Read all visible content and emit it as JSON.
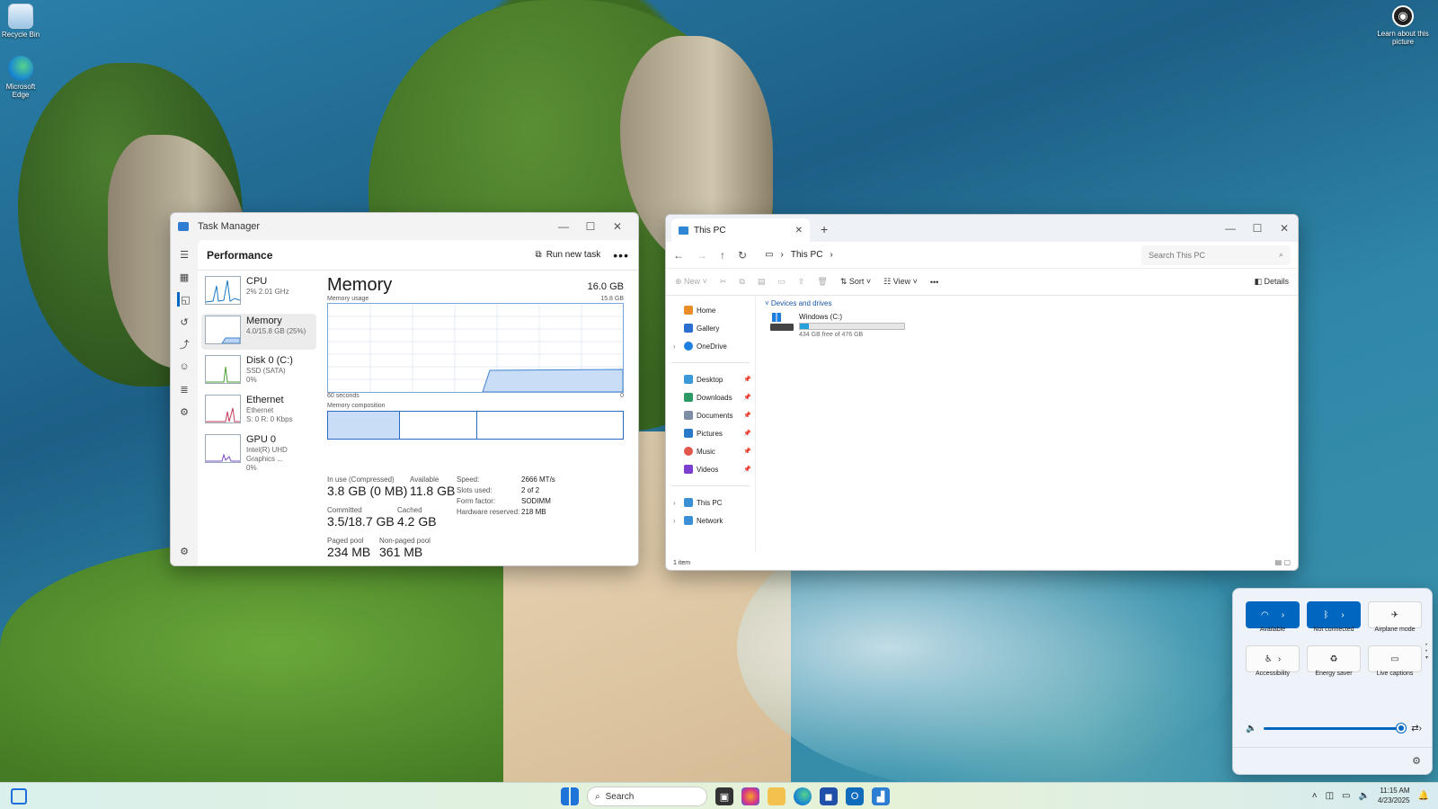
{
  "desktop": {
    "icons": [
      {
        "label": "Recycle Bin",
        "icon": "recycle-bin-icon"
      },
      {
        "label": "Microsoft Edge",
        "icon": "edge-icon"
      }
    ],
    "learn_label": "Learn about this picture"
  },
  "task_manager": {
    "title": "Task Manager",
    "section": "Performance",
    "run_new_task": "Run new task",
    "more": "•••",
    "perf_items": [
      {
        "name": "CPU",
        "sub1": "2% 2.01 GHz",
        "sub2": "",
        "color": "#1777c4"
      },
      {
        "name": "Memory",
        "sub1": "4.0/15.8 GB (25%)",
        "sub2": "",
        "color": "#3f83d1"
      },
      {
        "name": "Disk 0 (C:)",
        "sub1": "SSD (SATA)",
        "sub2": "0%",
        "color": "#4b9b2f"
      },
      {
        "name": "Ethernet",
        "sub1": "Ethernet",
        "sub2": "S: 0 R: 0 Kbps",
        "color": "#c33b5a"
      },
      {
        "name": "GPU 0",
        "sub1": "Intel(R) UHD Graphics ...",
        "sub2": "0%",
        "color": "#7a4cc2"
      }
    ],
    "memory": {
      "heading": "Memory",
      "total": "16.0 GB",
      "usage_label": "Memory usage",
      "usage_max": "15.8 GB",
      "time_left": "60 seconds",
      "time_right": "0",
      "composition_label": "Memory composition",
      "in_use_label": "In use (Compressed)",
      "in_use_value": "3.8 GB (0 MB)",
      "available_label": "Available",
      "available_value": "11.8 GB",
      "committed_label": "Committed",
      "committed_value": "3.5/18.7 GB",
      "cached_label": "Cached",
      "cached_value": "4.2 GB",
      "paged_label": "Paged pool",
      "paged_value": "234 MB",
      "nonpaged_label": "Non-paged pool",
      "nonpaged_value": "361 MB",
      "specs": [
        {
          "k": "Speed:",
          "v": "2666 MT/s"
        },
        {
          "k": "Slots used:",
          "v": "2 of 2"
        },
        {
          "k": "Form factor:",
          "v": "SODIMM"
        },
        {
          "k": "Hardware reserved:",
          "v": "218 MB"
        }
      ]
    }
  },
  "explorer": {
    "tab_title": "This PC",
    "breadcrumb": "This PC",
    "search_placeholder": "Search This PC",
    "cmd": {
      "new": "New",
      "sort": "Sort",
      "view": "View",
      "more": "•••",
      "details": "Details"
    },
    "nav": [
      {
        "label": "Home",
        "icon": "home-icon",
        "chev": "",
        "pin": false,
        "color": "#e88d2a"
      },
      {
        "label": "Gallery",
        "icon": "gallery-icon",
        "chev": "",
        "pin": false,
        "color": "#2a6fcf"
      },
      {
        "label": "OneDrive",
        "icon": "onedrive-icon",
        "chev": "›",
        "pin": false,
        "color": "#1f7fe0"
      },
      {
        "label": "Desktop",
        "icon": "desktop-folder-icon",
        "chev": "",
        "pin": true,
        "color": "#3a9ad9"
      },
      {
        "label": "Downloads",
        "icon": "downloads-icon",
        "chev": "",
        "pin": true,
        "color": "#2b9a64"
      },
      {
        "label": "Documents",
        "icon": "documents-icon",
        "chev": "",
        "pin": true,
        "color": "#7c8ea6"
      },
      {
        "label": "Pictures",
        "icon": "pictures-icon",
        "chev": "",
        "pin": true,
        "color": "#2a78c8"
      },
      {
        "label": "Music",
        "icon": "music-icon",
        "chev": "",
        "pin": true,
        "color": "#e2554b"
      },
      {
        "label": "Videos",
        "icon": "videos-icon",
        "chev": "",
        "pin": true,
        "color": "#7b3ed0"
      },
      {
        "label": "This PC",
        "icon": "this-pc-icon",
        "chev": "›",
        "pin": false,
        "color": "#3a8fd5"
      },
      {
        "label": "Network",
        "icon": "network-icon",
        "chev": "›",
        "pin": false,
        "color": "#3a8fd5"
      }
    ],
    "group": "Devices and drives",
    "drive_name": "Windows (C:)",
    "drive_free": "434 GB free of 476 GB",
    "drive_used_fraction": 0.088,
    "status": "1 item"
  },
  "quick_settings": {
    "tiles": [
      {
        "label": "Available",
        "icon": "wifi-icon",
        "on": true
      },
      {
        "label": "Not connected",
        "icon": "bluetooth-icon",
        "on": true
      },
      {
        "label": "Airplane mode",
        "icon": "airplane-icon",
        "on": false
      },
      {
        "label": "Accessibility",
        "icon": "accessibility-icon",
        "on": false
      },
      {
        "label": "Energy saver",
        "icon": "energy-saver-icon",
        "on": false
      },
      {
        "label": "Live captions",
        "icon": "live-captions-icon",
        "on": false
      }
    ],
    "volume_fraction": 1.0
  },
  "taskbar": {
    "search": "Search",
    "time": "11:15 AM",
    "date": "4/23/2025"
  }
}
